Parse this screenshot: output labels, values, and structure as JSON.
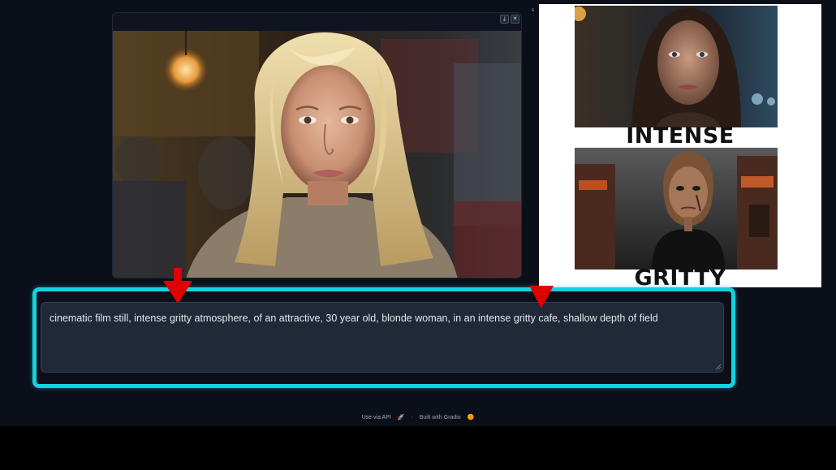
{
  "output_image": {
    "download_icon": "download-icon",
    "close_icon": "close-icon",
    "download_glyph": "⤓",
    "close_glyph": "✕"
  },
  "side_label": "s",
  "overlay": {
    "top_caption": "INTENSE",
    "bottom_caption": "GRITTY"
  },
  "prompt": {
    "value": "cinematic film still, intense gritty atmosphere, of an attractive, 30 year old, blonde woman, in an intense gritty cafe, shallow depth of field"
  },
  "footer": {
    "api_label": "Use via API",
    "separator": "·",
    "built_label": "Built with Gradio"
  },
  "colors": {
    "highlight": "#12d3e0",
    "arrow": "#e00000",
    "background": "#0b0f19"
  }
}
